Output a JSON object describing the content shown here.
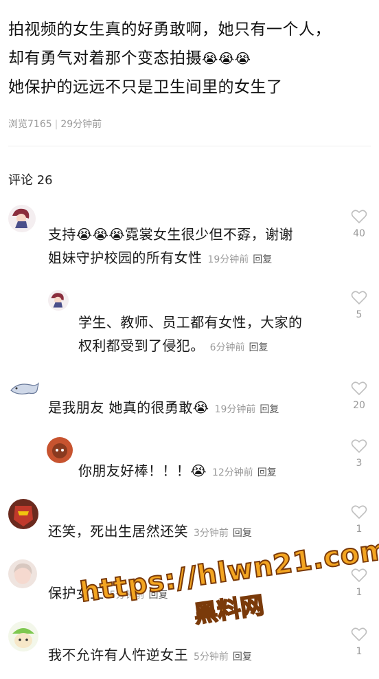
{
  "post": {
    "line1": "拍视频的女生真的好勇敢啊，她只有一个人，",
    "line2": "却有勇气对着那个变态拍摄",
    "line2_emoji": "😭😭😭",
    "line3": "她保护的远远不只是卫生间里的女生了"
  },
  "meta": {
    "views": "浏览7165",
    "time": "29分钟前"
  },
  "comments_header": "评论 26",
  "comments": [
    {
      "text_a": "支持",
      "emoji": "😭😭😭",
      "text_b": "霓裳女生很少但不孬，谢谢",
      "text_c": "姐妹守护校园的所有女性",
      "time": "19分钟前",
      "reply": "回复",
      "likes": "40"
    },
    {
      "text_a": "学生、教师、员工都有女性，大家的",
      "text_b": "权利都受到了侵犯。",
      "time": "6分钟前",
      "reply": "回复",
      "likes": "5"
    },
    {
      "text_a": "是我朋友 她真的很勇敢",
      "emoji": "😭",
      "time": "19分钟前",
      "reply": "回复",
      "likes": "20"
    },
    {
      "text_a": "你朋友好棒！！！",
      "emoji": "😭",
      "time": "12分钟前",
      "reply": "回复",
      "likes": "3"
    },
    {
      "text_a": "还笑，死出生居然还笑",
      "time": "3分钟前",
      "reply": "回复",
      "likes": "1"
    },
    {
      "text_a": "保护女王",
      "time": "5分钟前",
      "reply": "回复",
      "likes": "1"
    },
    {
      "text_a": "我不允许有人忤逆女王",
      "time": "5分钟前",
      "reply": "回复",
      "likes": "1"
    }
  ],
  "watermark": {
    "url": "https://hlwn21.com",
    "name": "黑料网"
  },
  "colors": {
    "heart": "#bfbfbf",
    "watermark": "#f3a521"
  }
}
